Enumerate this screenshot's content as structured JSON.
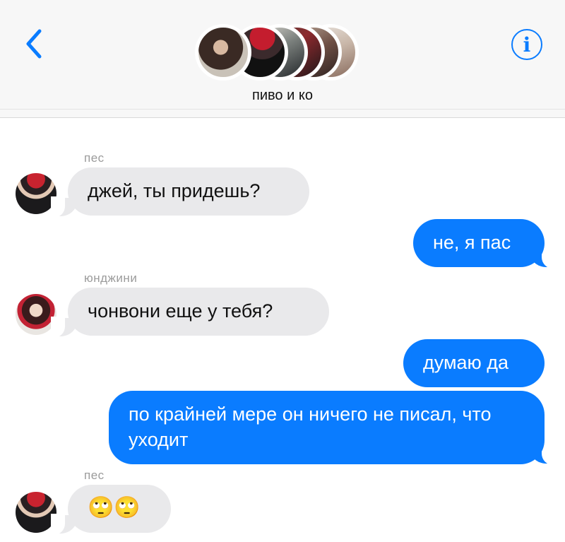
{
  "header": {
    "group_name": "пиво и ко",
    "back_icon": "chevron-left-icon",
    "info_icon": "info-icon",
    "info_glyph": "i",
    "accent_color": "#0a7cff"
  },
  "messages": [
    {
      "direction": "incoming",
      "sender": "пес",
      "text": "джей, ты придешь?"
    },
    {
      "direction": "outgoing",
      "text": "не, я пас"
    },
    {
      "direction": "incoming",
      "sender": "юнджини",
      "text": "чонвони еще у тебя?"
    },
    {
      "direction": "outgoing",
      "text": "думаю да"
    },
    {
      "direction": "outgoing",
      "text": "по крайней мере он ничего не писал, что уходит"
    },
    {
      "direction": "incoming",
      "sender": "пес",
      "text": "🙄🙄"
    }
  ],
  "colors": {
    "incoming_bubble": "#e9e9eb",
    "outgoing_bubble": "#0a7cff",
    "sender_label": "#9b9b9b"
  }
}
